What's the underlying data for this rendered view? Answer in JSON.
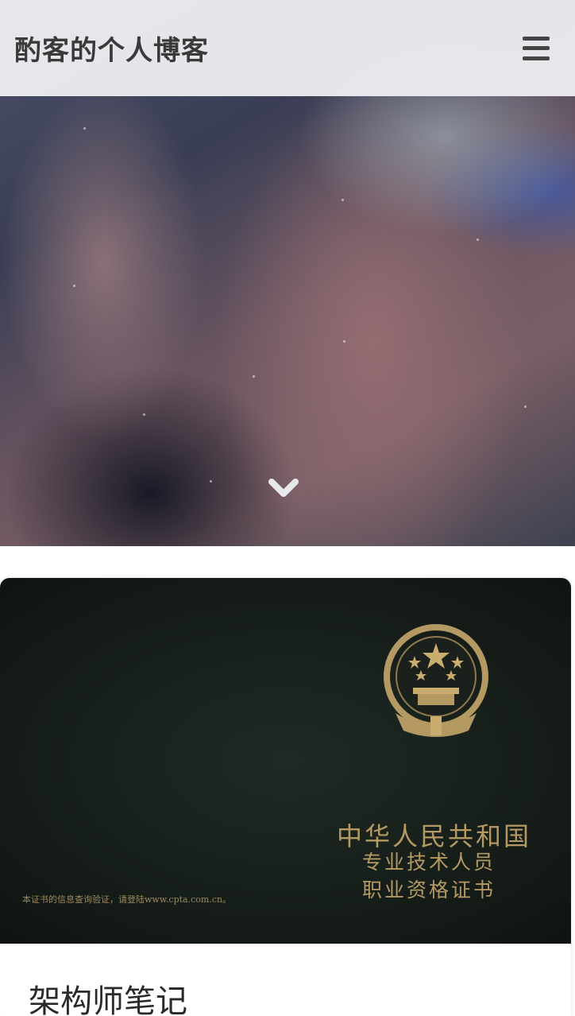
{
  "header": {
    "title": "酌客的个人博客",
    "menu_icon": "hamburger-menu-icon"
  },
  "hero": {
    "scroll_icon": "chevron-down-icon"
  },
  "post_card": {
    "title": "架构师笔记",
    "image": {
      "emblem": "national-emblem-icon",
      "country_text": "中华人民共和国",
      "line1": "专业技术人员",
      "line2": "职业资格证书",
      "note": "本证书的信息查询验证，请登陆www.cpta.com.cn。"
    }
  }
}
